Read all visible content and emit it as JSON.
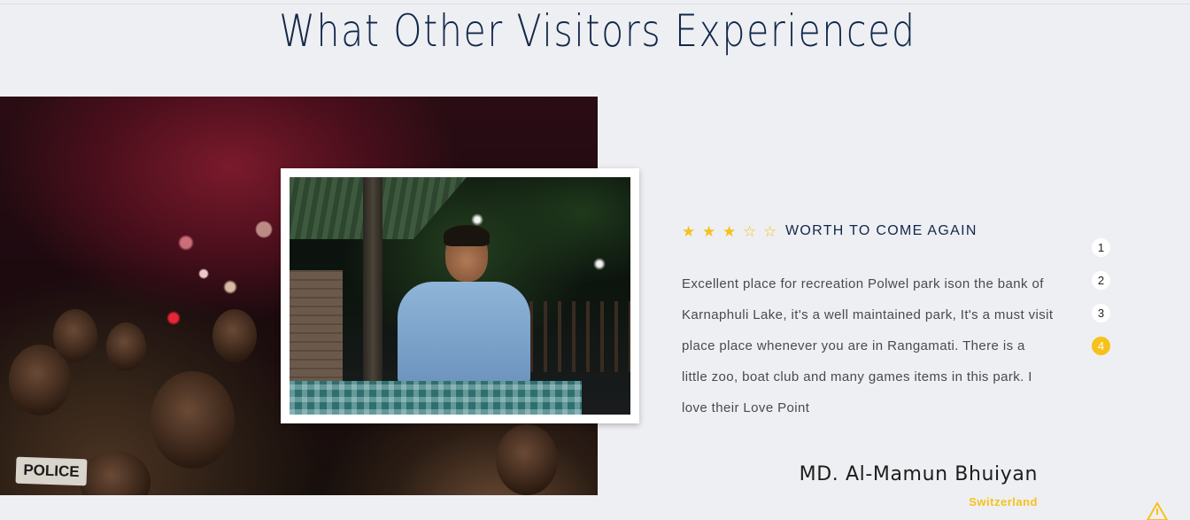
{
  "section": {
    "title": "What Other Visitors Experienced"
  },
  "hero": {
    "police_label": "POLICE"
  },
  "review": {
    "rating": 3,
    "max_rating": 5,
    "stars": [
      "★",
      "★",
      "★",
      "☆",
      "☆"
    ],
    "title": "WORTH TO COME AGAIN",
    "text": "Excellent place for recreation Polwel park ison the bank of Karnaphuli Lake, it's a well maintained park, It's a must visit place place whenever you are in Rangamati. There is a little zoo, boat club and many games items in this park. I love their Love Point",
    "author": "MD. Al-Mamun Bhuiyan",
    "country": "Switzerland"
  },
  "pager": {
    "items": [
      "1",
      "2",
      "3",
      "4"
    ],
    "active_index": 3
  },
  "colors": {
    "accent": "#f6c11a",
    "title": "#12284a",
    "background": "#eeeff3"
  },
  "icons": {
    "corner": "warning-triangle-icon"
  }
}
